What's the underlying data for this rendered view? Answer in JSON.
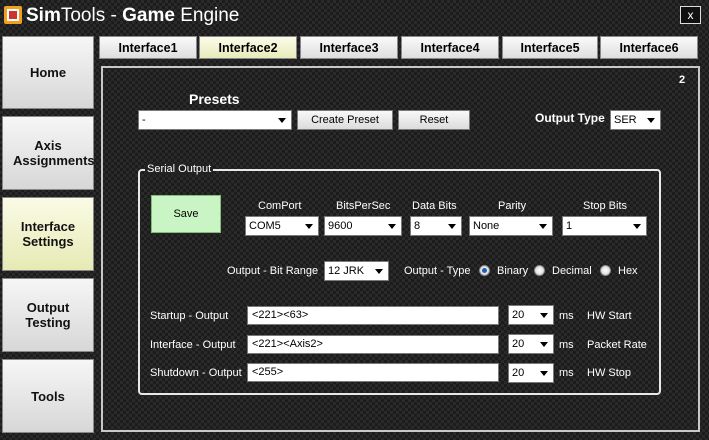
{
  "title": {
    "brand_bold": "Sim",
    "brand_rest": "Tools - ",
    "app_bold": "Game",
    "app_rest": " Engine"
  },
  "close_label": "x",
  "nav": [
    {
      "label": "Home"
    },
    {
      "label": "Axis Assignments"
    },
    {
      "label": "Interface Settings",
      "active": true
    },
    {
      "label": "Output Testing"
    },
    {
      "label": "Tools"
    }
  ],
  "tabs": [
    "Interface1",
    "Interface2",
    "Interface3",
    "Interface4",
    "Interface5",
    "Interface6"
  ],
  "active_tab": "Interface2",
  "panel_number": "2",
  "presets": {
    "heading": "Presets",
    "selected": "-",
    "create_label": "Create Preset",
    "reset_label": "Reset"
  },
  "output_type": {
    "label": "Output Type",
    "value": "SER"
  },
  "serial": {
    "group_label": "Serial Output",
    "save_label": "Save",
    "comport": {
      "label": "ComPort",
      "value": "COM5"
    },
    "bitspersec": {
      "label": "BitsPerSec",
      "value": "9600"
    },
    "databits": {
      "label": "Data Bits",
      "value": "8"
    },
    "parity": {
      "label": "Parity",
      "value": "None"
    },
    "stopbits": {
      "label": "Stop Bits",
      "value": "1"
    },
    "bitrange": {
      "label": "Output - Bit Range",
      "value": "12 JRK"
    },
    "outtype": {
      "label": "Output - Type",
      "options": [
        "Binary",
        "Decimal",
        "Hex"
      ],
      "selected": "Binary"
    },
    "startup": {
      "label": "Startup - Output",
      "value": "<221><63>",
      "ms": "20",
      "unit": "ms",
      "note": "HW Start"
    },
    "interface": {
      "label": "Interface - Output",
      "value": "<221><Axis2>",
      "ms": "20",
      "unit": "ms",
      "note": "Packet Rate"
    },
    "shutdown": {
      "label": "Shutdown - Output",
      "value": "<255>",
      "ms": "20",
      "unit": "ms",
      "note": "HW Stop"
    }
  }
}
